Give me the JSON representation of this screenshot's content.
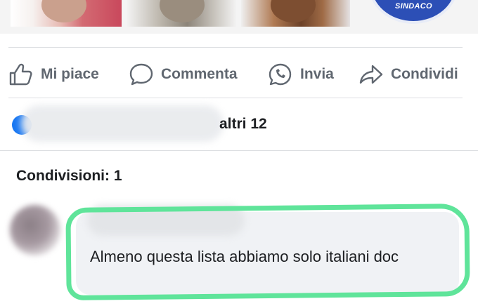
{
  "header_logo": {
    "text": "SINDACO",
    "color": "#2c4fb6"
  },
  "actions": [
    {
      "label": "Mi piace",
      "icon": "like-icon"
    },
    {
      "label": "Commenta",
      "icon": "comment-icon"
    },
    {
      "label": "Invia",
      "icon": "whatsapp-icon"
    },
    {
      "label": "Condividi",
      "icon": "share-icon"
    }
  ],
  "reactions": {
    "others_text": "altri 12",
    "icon": "like-reaction-icon",
    "icon_color": "#1877f2"
  },
  "shares": {
    "text": "Condivisioni: 1"
  },
  "comment": {
    "text": "Almeno questa lista abbiamo solo italiani doc",
    "highlight_color": "#5fe49a"
  }
}
